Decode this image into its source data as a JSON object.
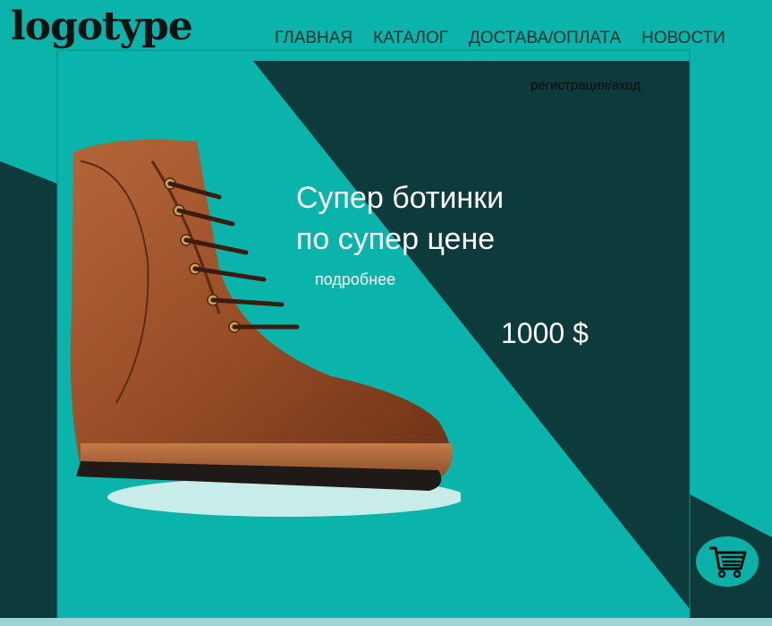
{
  "logo": {
    "text": "logotype"
  },
  "nav": {
    "items": [
      {
        "label": "ГЛАВНАЯ"
      },
      {
        "label": "КАТАЛОГ"
      },
      {
        "label": "ДОСТАВА/ОПЛАТА"
      },
      {
        "label": "НОВОСТИ"
      }
    ]
  },
  "header": {
    "login_text": "регистрация/вход"
  },
  "hero": {
    "headline_line1": "Супер ботинки",
    "headline_line2": "по супер цене",
    "more_label": "подробнее",
    "price": "1000 $"
  },
  "icons": {
    "cart": "shopping-cart-icon",
    "product": "boot-image"
  },
  "colors": {
    "teal": "#0ab4aa",
    "dark": "#0d3a3a",
    "text_light": "#ffffff"
  }
}
